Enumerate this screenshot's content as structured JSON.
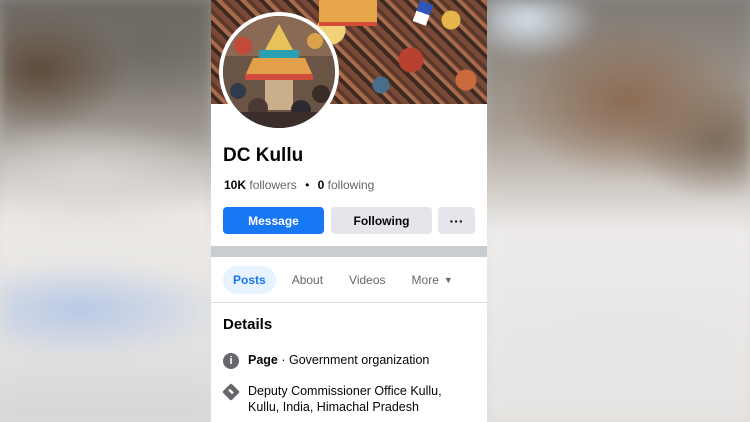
{
  "profile": {
    "name": "DC Kullu",
    "followers_count": "10K",
    "followers_label": "followers",
    "following_count": "0",
    "following_label": "following"
  },
  "actions": {
    "message_label": "Message",
    "following_label": "Following",
    "more_label": "···"
  },
  "tabs": [
    {
      "label": "Posts"
    },
    {
      "label": "About"
    },
    {
      "label": "Videos"
    },
    {
      "label": "More"
    }
  ],
  "details": {
    "title": "Details",
    "page_type_prefix": "Page",
    "page_type": " · Government organization",
    "address": "Deputy Commissioner Office Kullu, Kullu, India, Himachal Pradesh"
  },
  "colors": {
    "accent": "#1877f2",
    "secondary_button": "#e4e6eb",
    "text_primary": "#050505",
    "text_secondary": "#65676b"
  },
  "icons": [
    "info-icon",
    "directions-icon",
    "caret-down-icon",
    "more-dots-icon"
  ]
}
